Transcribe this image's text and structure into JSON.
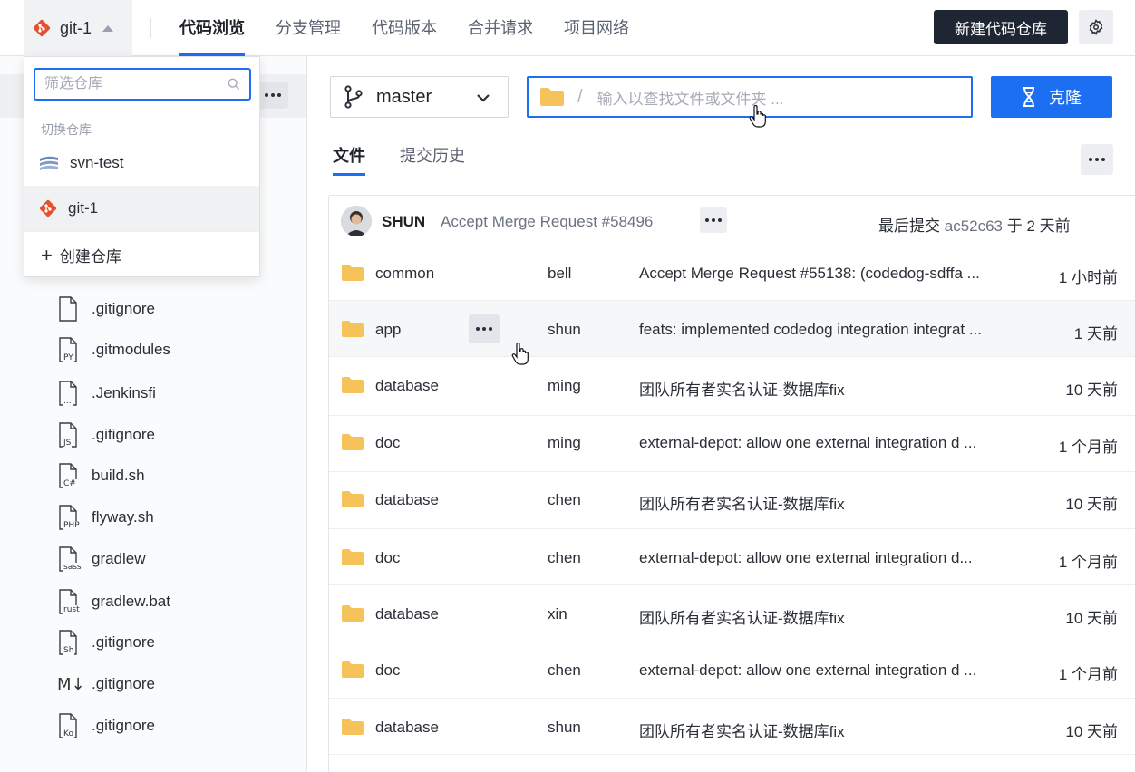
{
  "header": {
    "repo_name": "git-1",
    "tabs": [
      {
        "label": "代码浏览"
      },
      {
        "label": "分支管理"
      },
      {
        "label": "代码版本"
      },
      {
        "label": "合并请求"
      },
      {
        "label": "项目网络"
      }
    ],
    "new_repo_label": "新建代码仓库",
    "accent": "#1d6ff2"
  },
  "dropdown": {
    "search_placeholder": "筛选仓库",
    "section_label": "切换仓库",
    "repos": [
      {
        "name": "svn-test",
        "icon": "svn-icon"
      },
      {
        "name": "git-1",
        "icon": "git-icon"
      }
    ],
    "create_label": "创建仓库"
  },
  "sidebar": {
    "files": [
      {
        "name": ".gitignore",
        "badge": ""
      },
      {
        "name": ".gitmodules",
        "badge": "PY"
      },
      {
        "name": ".Jenkinsfi",
        "badge": "..."
      },
      {
        "name": ".gitignore",
        "badge": "JS"
      },
      {
        "name": "build.sh",
        "badge": "C#"
      },
      {
        "name": "flyway.sh",
        "badge": "PHP"
      },
      {
        "name": "gradlew",
        "badge": "sass"
      },
      {
        "name": "gradlew.bat",
        "badge": "rust"
      },
      {
        "name": ".gitignore",
        "badge": "Sh"
      },
      {
        "name": ".gitignore",
        "badge": "M↓"
      },
      {
        "name": ".gitignore",
        "badge": "Ko"
      }
    ]
  },
  "toolbar": {
    "branch": "master",
    "path_placeholder": "输入以查找文件或文件夹 ...",
    "clone_label": "克隆",
    "subtabs": [
      {
        "label": "文件"
      },
      {
        "label": "提交历史"
      }
    ]
  },
  "commit": {
    "user": "SHUN",
    "message": "Accept Merge Request #58496",
    "last_label": "最后提交",
    "hash": "ac52c63",
    "time": "于 2 天前"
  },
  "rows": [
    {
      "name": "common",
      "author": "bell",
      "message": "Accept Merge Request #55138: (codedog-sdffa ...",
      "time": "1 小时前"
    },
    {
      "name": "app",
      "author": "shun",
      "message": "feats: implemented codedog integration integrat ...",
      "time": "1 天前"
    },
    {
      "name": "database",
      "author": "ming",
      "message": "团队所有者实名认证-数据库fix",
      "time": "10 天前"
    },
    {
      "name": "doc",
      "author": "ming",
      "message": "external-depot: allow one external integration d ...",
      "time": "1 个月前"
    },
    {
      "name": "database",
      "author": "chen",
      "message": "团队所有者实名认证-数据库fix",
      "time": "10 天前"
    },
    {
      "name": "doc",
      "author": "chen",
      "message": "external-depot: allow one external integration d...",
      "time": "1 个月前"
    },
    {
      "name": "database",
      "author": "xin",
      "message": "团队所有者实名认证-数据库fix",
      "time": "10 天前"
    },
    {
      "name": "doc",
      "author": "chen",
      "message": "external-depot: allow one external integration d ...",
      "time": "1 个月前"
    },
    {
      "name": "database",
      "author": "shun",
      "message": "团队所有者实名认证-数据库fix",
      "time": "10 天前"
    }
  ]
}
